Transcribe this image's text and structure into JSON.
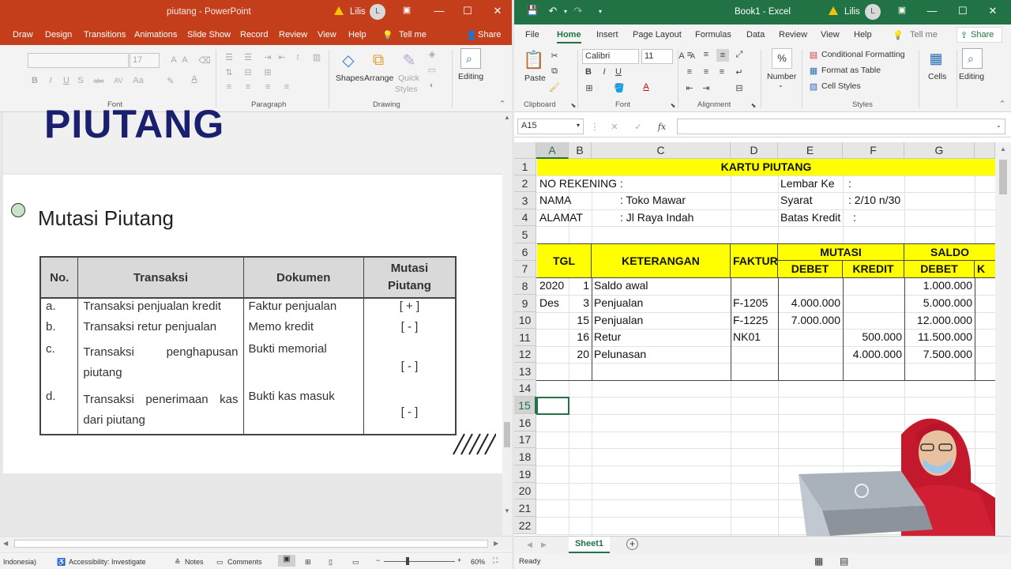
{
  "ppt": {
    "title": "piutang - PowerPoint",
    "user": "Lilis",
    "user_initial": "L",
    "menu": [
      "Draw",
      "Design",
      "Transitions",
      "Animations",
      "Slide Show",
      "Record",
      "Review",
      "View",
      "Help",
      "Tell me",
      "Share"
    ],
    "ribbon": {
      "font_size": "17",
      "group_font": "Font",
      "group_paragraph": "Paragraph",
      "group_drawing": "Drawing",
      "shapes": "Shapes",
      "arrange": "Arrange",
      "quick": "Quick",
      "styles": "Styles",
      "editing": "Editing"
    },
    "slide": {
      "title": "PIUTANG",
      "bullet": "Mutasi Piutang",
      "table": {
        "headers": [
          "No.",
          "Transaksi",
          "Dokumen",
          "Mutasi Piutang"
        ],
        "rows": [
          {
            "no": "a.",
            "transaksi": "Transaksi penjualan kredit",
            "dokumen": "Faktur penjualan",
            "mutasi": "[ + ]"
          },
          {
            "no": "b.",
            "transaksi": "Transaksi retur penjualan",
            "dokumen": "Memo kredit",
            "mutasi": "[ - ]"
          },
          {
            "no": "c.",
            "transaksi": "Transaksi penghapusan piutang",
            "dokumen": "Bukti memorial",
            "mutasi": "[ - ]"
          },
          {
            "no": "d.",
            "transaksi": "Transaksi penerimaan kas dari piutang",
            "dokumen": "Bukti kas masuk",
            "mutasi": "[ - ]"
          }
        ]
      }
    },
    "status": {
      "lang": "Indonesia)",
      "accessibility": "Accessibility: Investigate",
      "notes": "Notes",
      "comments": "Comments",
      "zoom": "60%"
    }
  },
  "excel": {
    "title": "Book1 - Excel",
    "user": "Lilis",
    "user_initial": "L",
    "menu": [
      "File",
      "Home",
      "Insert",
      "Page Layout",
      "Formulas",
      "Data",
      "Review",
      "View",
      "Help",
      "Tell me",
      "Share"
    ],
    "ribbon": {
      "paste": "Paste",
      "clipboard": "Clipboard",
      "font_name": "Calibri",
      "font_size": "11",
      "font": "Font",
      "alignment": "Alignment",
      "number": "Number",
      "percent": "%",
      "conditional": "Conditional Formatting",
      "format_table": "Format as Table",
      "cell_styles": "Cell Styles",
      "styles": "Styles",
      "cells": "Cells",
      "editing": "Editing"
    },
    "name_box": "A15",
    "fx": "fx",
    "columns": [
      "A",
      "B",
      "C",
      "D",
      "E",
      "F",
      "G"
    ],
    "rows": [
      "1",
      "2",
      "3",
      "4",
      "5",
      "6",
      "7",
      "8",
      "9",
      "10",
      "11",
      "12",
      "13",
      "14",
      "15",
      "16",
      "17",
      "18",
      "19",
      "20",
      "21",
      "22"
    ],
    "sheet": {
      "r1": "KARTU PIUTANG",
      "r2a": "NO REKENING  :",
      "r2e": "Lembar Ke",
      "r2f": ":",
      "r3a": "NAMA",
      "r3c": ": Toko Mawar",
      "r3e": "Syarat",
      "r3f": ": 2/10 n/30",
      "r4a": "ALAMAT",
      "r4c": ": Jl Raya Indah",
      "r4e": "Batas Kredit",
      "r4f": ":",
      "h_tgl": "TGL",
      "h_ket": "KETERANGAN",
      "h_faktur": "FAKTUR",
      "h_mutasi": "MUTASI",
      "h_saldo": "SALDO",
      "h_debet": "DEBET",
      "h_kredit": "KREDIT",
      "h_sdebet": "DEBET",
      "h_sk": "K",
      "data": [
        {
          "a": "2020",
          "b": "1",
          "c": "Saldo awal",
          "d": "",
          "e": "",
          "f": "",
          "g": "1.000.000"
        },
        {
          "a": "Des",
          "b": "3",
          "c": "Penjualan",
          "d": "F-1205",
          "e": "4.000.000",
          "f": "",
          "g": "5.000.000"
        },
        {
          "a": "",
          "b": "15",
          "c": "Penjualan",
          "d": "F-1225",
          "e": "7.000.000",
          "f": "",
          "g": "12.000.000"
        },
        {
          "a": "",
          "b": "16",
          "c": "Retur",
          "d": "NK01",
          "e": "",
          "f": "500.000",
          "g": "11.500.000"
        },
        {
          "a": "",
          "b": "20",
          "c": "Pelunasan",
          "d": "",
          "e": "",
          "f": "4.000.000",
          "g": "7.500.000"
        }
      ]
    },
    "sheet_tab": "Sheet1",
    "status": "Ready"
  }
}
